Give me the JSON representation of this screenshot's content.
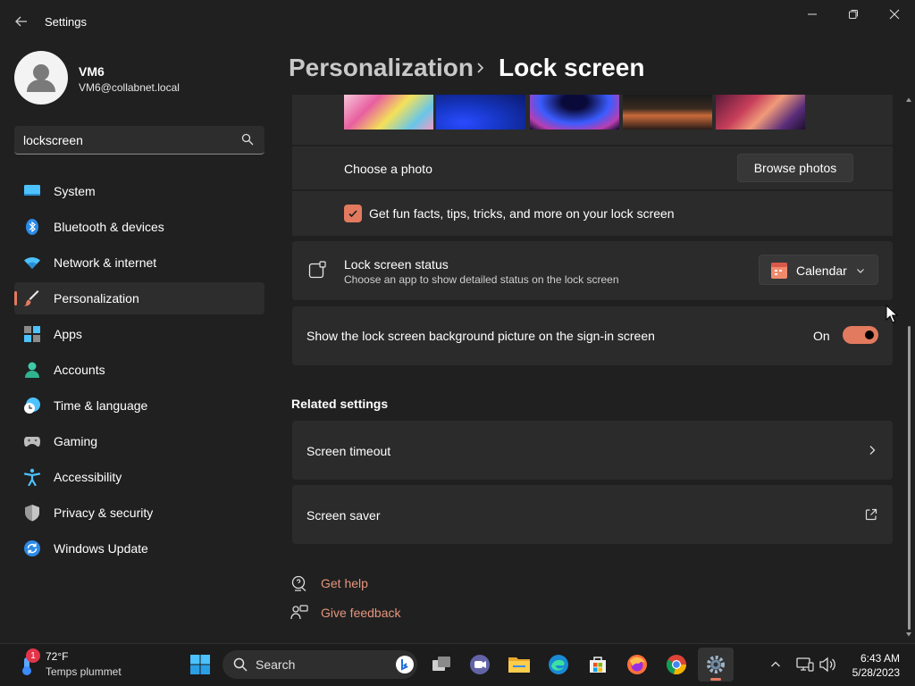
{
  "window": {
    "title": "Settings",
    "controls": [
      "minimize-icon",
      "restore-icon",
      "close-icon"
    ]
  },
  "profile": {
    "name": "VM6",
    "email": "VM6@collabnet.local"
  },
  "search": {
    "value": "lockscreen"
  },
  "sidebar": {
    "items": [
      {
        "label": "System",
        "icon": "system-icon"
      },
      {
        "label": "Bluetooth & devices",
        "icon": "bluetooth-icon"
      },
      {
        "label": "Network & internet",
        "icon": "wifi-icon"
      },
      {
        "label": "Personalization",
        "icon": "brush-icon",
        "active": true
      },
      {
        "label": "Apps",
        "icon": "apps-icon"
      },
      {
        "label": "Accounts",
        "icon": "accounts-icon"
      },
      {
        "label": "Time & language",
        "icon": "time-language-icon"
      },
      {
        "label": "Gaming",
        "icon": "gaming-icon"
      },
      {
        "label": "Accessibility",
        "icon": "accessibility-icon"
      },
      {
        "label": "Privacy & security",
        "icon": "shield-icon"
      },
      {
        "label": "Windows Update",
        "icon": "windows-update-icon"
      }
    ]
  },
  "header": {
    "parent": "Personalization",
    "current": "Lock screen"
  },
  "lockscreen": {
    "choose_photo_label": "Choose a photo",
    "browse_button": "Browse photos",
    "fun_facts_label": "Get fun facts, tips, tricks, and more on your lock screen",
    "fun_facts_checked": true,
    "status_title": "Lock screen status",
    "status_desc": "Choose an app to show detailed status on the lock screen",
    "status_app": "Calendar",
    "signin_label": "Show the lock screen background picture on the sign-in screen",
    "signin_state": "On"
  },
  "related": {
    "title": "Related settings",
    "items": [
      {
        "label": "Screen timeout",
        "icon": "chevron-right-icon"
      },
      {
        "label": "Screen saver",
        "icon": "external-link-icon"
      }
    ]
  },
  "help": {
    "get_help": "Get help",
    "give_feedback": "Give feedback"
  },
  "taskbar": {
    "weather_temp": "72°F",
    "weather_desc": "Temps plummet",
    "weather_badge": "1",
    "search_placeholder": "Search",
    "time": "6:43 AM",
    "date": "5/28/2023"
  },
  "colors": {
    "accent": "#e27a5f",
    "background": "#202020",
    "card": "#2b2b2b",
    "link": "#e5957c"
  }
}
